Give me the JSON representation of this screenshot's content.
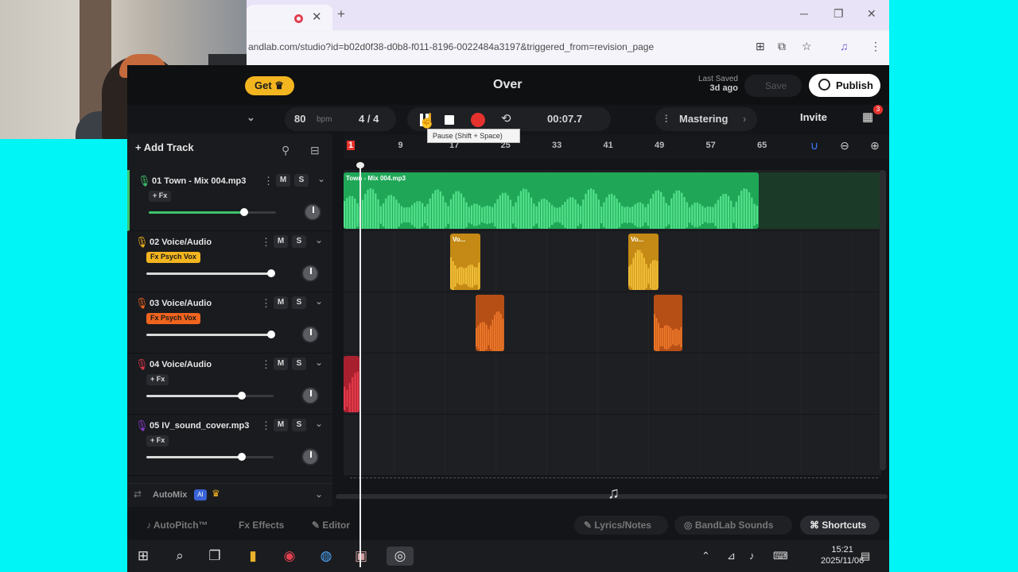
{
  "browser": {
    "url": "andlab.com/studio?id=b02d0f38-d0b8-f011-8196-0022484a3197&triggered_from=revision_page",
    "tab_close": "✕",
    "new_tab": "+",
    "window_min": "─",
    "window_max": "❐",
    "window_close": "✕"
  },
  "app": {
    "get_label": "Get",
    "project_title": "Over",
    "last_saved_label": "Last Saved",
    "last_saved_value": "3d ago",
    "save_label": "Save",
    "publish_label": "Publish",
    "invite_label": "Invite",
    "notification_count": "3"
  },
  "transport": {
    "bpm": "80",
    "bpm_unit": "bpm",
    "time_signature": "4 / 4",
    "time": "00:07.7",
    "mastering_label": "Mastering",
    "tooltip": "Pause (Shift + Space)"
  },
  "sidebar": {
    "add_track_label": "+ Add Track",
    "tracks": [
      {
        "name": "01 Town - Mix 004.mp3",
        "fx": "+ Fx",
        "color": "#3ec46d",
        "fx_active": false,
        "volume": 0.75
      },
      {
        "name": "02 Voice/Audio",
        "fx": "Fx Psych Vox",
        "color": "#f3b51f",
        "fx_active": true,
        "volume": 0.98
      },
      {
        "name": "03 Voice/Audio",
        "fx": "Fx Psych Vox",
        "color": "#f0641e",
        "fx_active": true,
        "volume": 0.98
      },
      {
        "name": "04 Voice/Audio",
        "fx": "+ Fx",
        "color": "#e23a4a",
        "fx_active": false,
        "volume": 0.75
      },
      {
        "name": "05 IV_sound_cover.mp3",
        "fx": "+ Fx",
        "color": "#8a3ccf",
        "fx_active": false,
        "volume": 0.75
      }
    ],
    "mute_label": "M",
    "solo_label": "S",
    "automix_label": "AutoMix",
    "ai_badge": "AI"
  },
  "timeline": {
    "ruler_ticks": [
      "1",
      "9",
      "17",
      "25",
      "33",
      "41",
      "49",
      "57",
      "65"
    ],
    "clips": [
      {
        "label": "Town - Mix 004.mp3"
      },
      {
        "label": "Vo..."
      },
      {
        "label": "Vo..."
      }
    ]
  },
  "bottom": {
    "autopitch": "AutoPitch™",
    "effects": "Effects",
    "editor": "Editor",
    "lyrics": "Lyrics/Notes",
    "sounds": "BandLab Sounds",
    "shortcuts": "Shortcuts"
  },
  "taskbar": {
    "time": "15:21",
    "date": "2025/11/06"
  },
  "icons": [
    "search-icon",
    "pause-icon",
    "stop-icon",
    "record-icon",
    "loop-icon",
    "zoom-in-icon",
    "zoom-out-icon",
    "magnet-icon",
    "calendar-icon",
    "crown-icon",
    "windows-icon",
    "chrome-icon"
  ]
}
